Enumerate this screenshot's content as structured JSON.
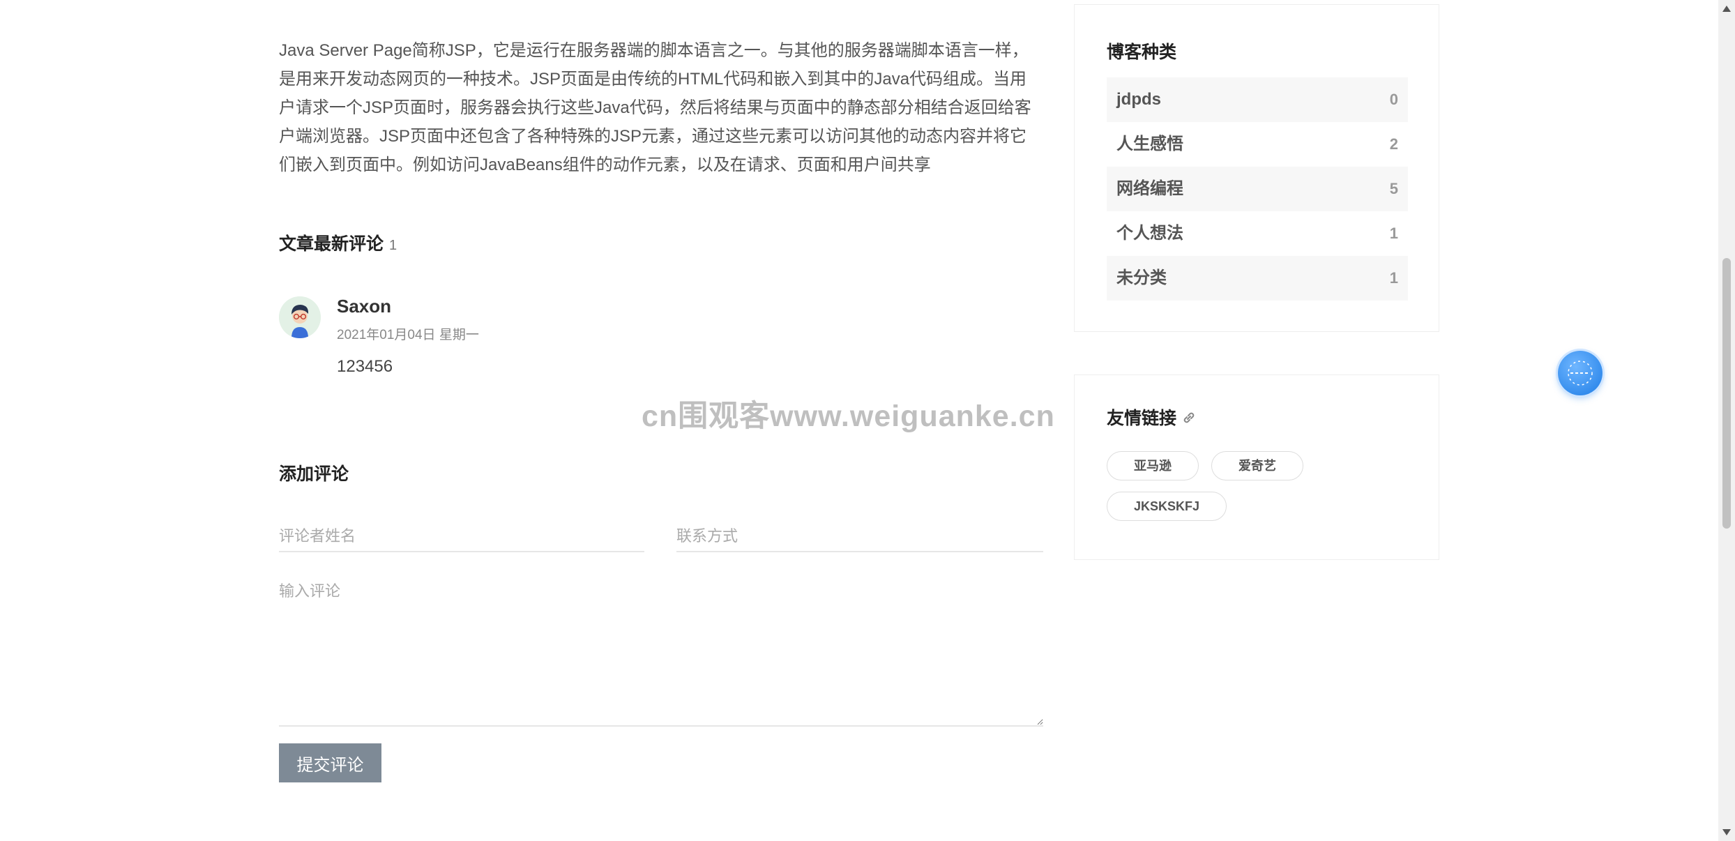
{
  "article": {
    "body": "Java Server Page简称JSP，它是运行在服务器端的脚本语言之一。与其他的服务器端脚本语言一样，是用来开发动态网页的一种技术。JSP页面是由传统的HTML代码和嵌入到其中的Java代码组成。当用户请求一个JSP页面时，服务器会执行这些Java代码，然后将结果与页面中的静态部分相结合返回给客户端浏览器。JSP页面中还包含了各种特殊的JSP元素，通过这些元素可以访问其他的动态内容并将它们嵌入到页面中。例如访问JavaBeans组件的动作元素，以及在请求、页面和用户间共享"
  },
  "comments": {
    "title": "文章最新评论",
    "count": "1",
    "items": [
      {
        "author": "Saxon",
        "date": "2021年01月04日  星期一",
        "content": "123456"
      }
    ]
  },
  "comment_form": {
    "title": "添加评论",
    "name_placeholder": "评论者姓名",
    "contact_placeholder": "联系方式",
    "comment_placeholder": "输入评论",
    "submit_label": "提交评论"
  },
  "sidebar": {
    "categories": {
      "title": "博客种类",
      "items": [
        {
          "label": "jdpds",
          "count": "0"
        },
        {
          "label": "人生感悟",
          "count": "2"
        },
        {
          "label": "网络编程",
          "count": "5"
        },
        {
          "label": "个人想法",
          "count": "1"
        },
        {
          "label": "未分类",
          "count": "1"
        }
      ]
    },
    "links": {
      "title": "友情链接",
      "icon": "link-icon",
      "items": [
        "亚马逊",
        "爱奇艺",
        "JKSKSKFJ"
      ]
    }
  },
  "watermark": "cn围观客www.weiguanke.cn",
  "colors": {
    "submit_button": "#7e8a96",
    "float_button": "#1e7de6",
    "category_row_alt": "#f7f7f7"
  }
}
